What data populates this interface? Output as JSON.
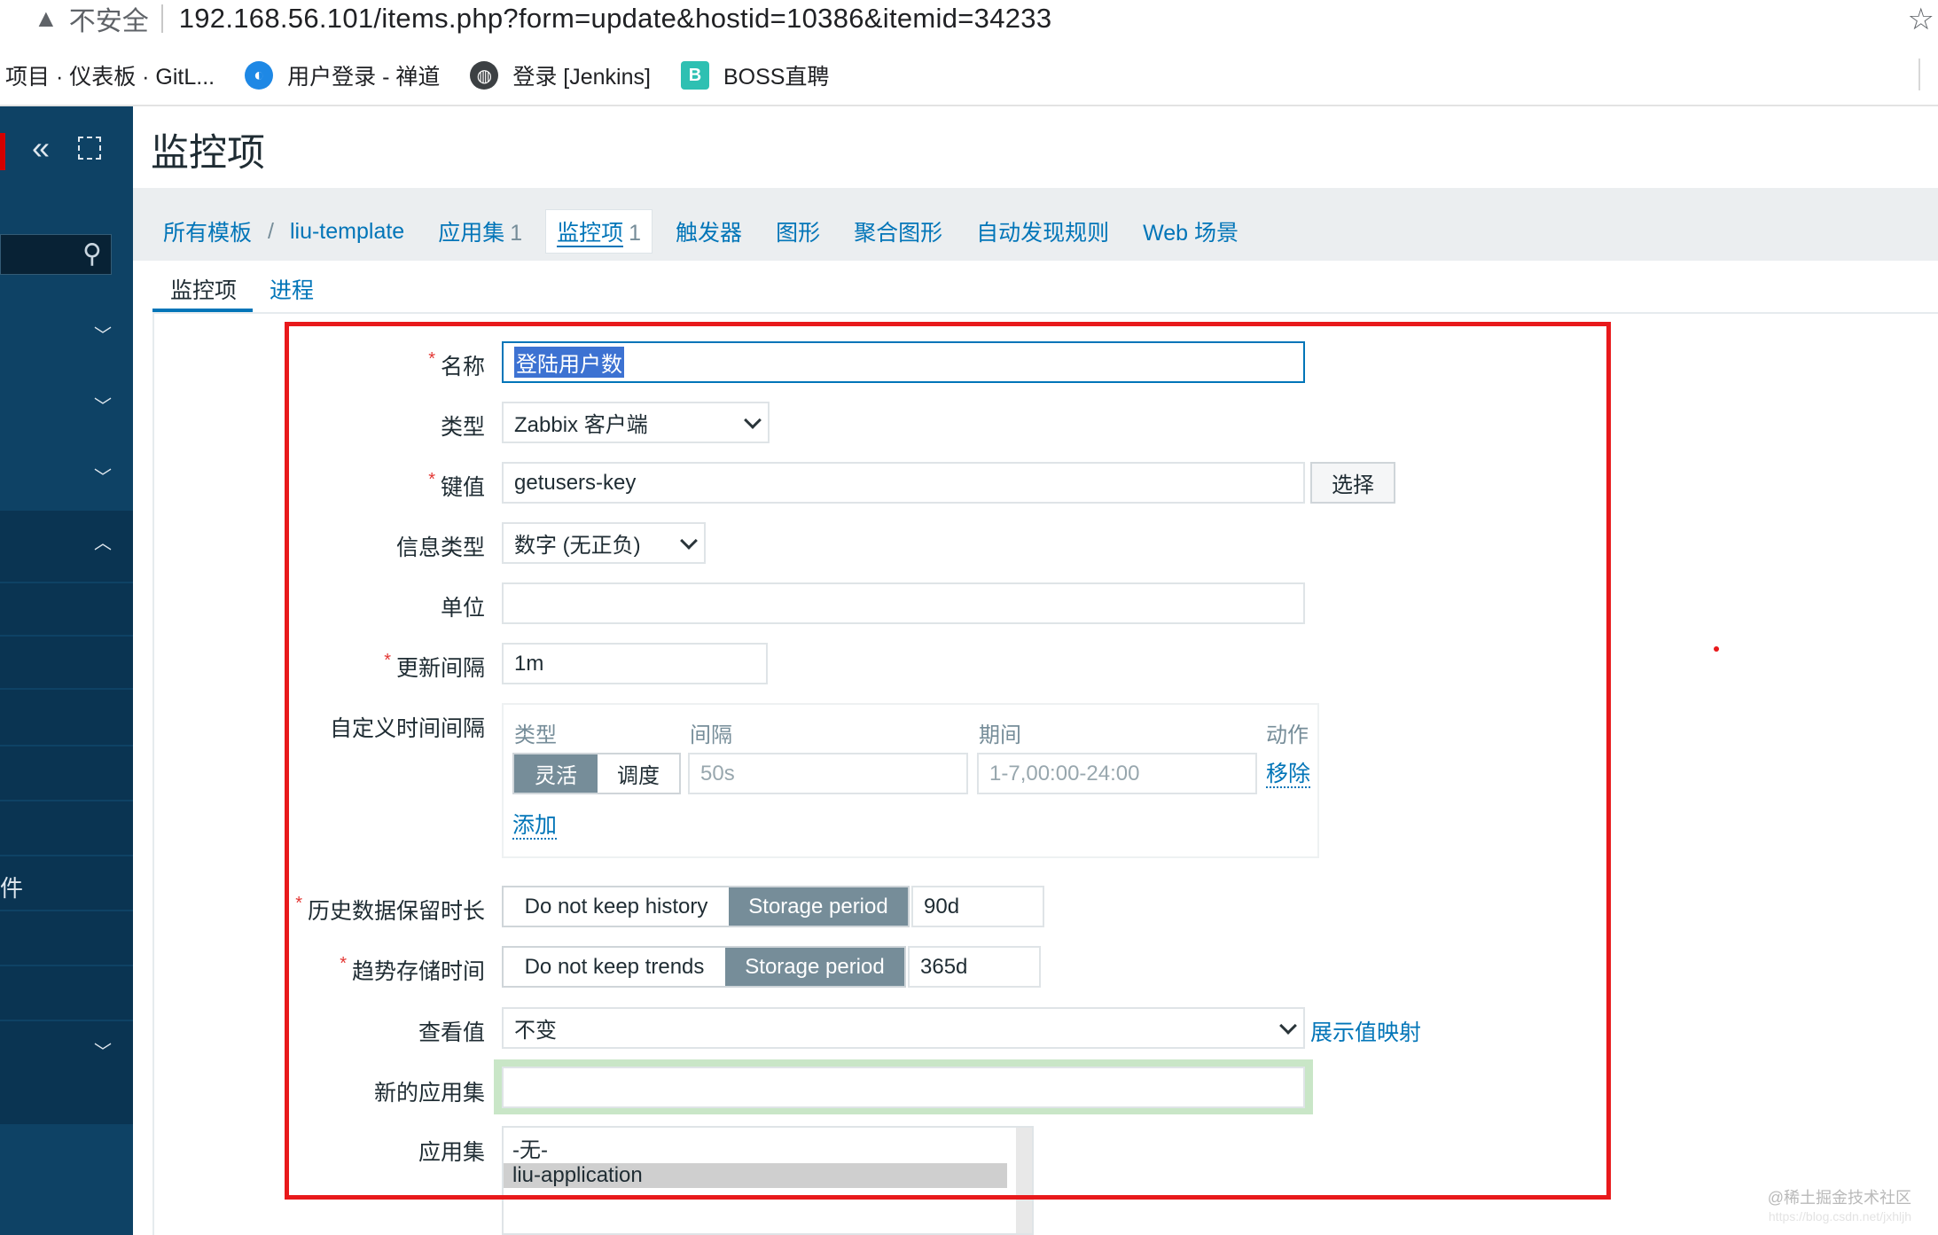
{
  "browser": {
    "insecure_label": "不安全",
    "url": "192.168.56.101/items.php?form=update&hostid=10386&itemid=34233",
    "bookmarks": [
      {
        "label": "项目 · 仪表板 · GitL...",
        "icon": ""
      },
      {
        "label": "用户登录 - 禅道",
        "icon": "chandao-icon",
        "color": "#1e88e5"
      },
      {
        "label": "登录 [Jenkins]",
        "icon": "globe-icon",
        "color": "#3c4043"
      },
      {
        "label": "BOSS直聘",
        "icon": "boss-icon",
        "color": "#2ec0b2",
        "glyph": "B"
      }
    ]
  },
  "sidebar": {
    "fragments": [
      "",
      "",
      "件"
    ],
    "colors": {
      "bg": "#0e4265",
      "active": "#0a3452"
    }
  },
  "header": {
    "title": "监控项"
  },
  "breadcrumb": {
    "all_templates": "所有模板",
    "template": "liu-template",
    "applications": "应用集",
    "applications_count": "1",
    "items": "监控项",
    "items_count": "1",
    "triggers": "触发器",
    "graphs": "图形",
    "screens": "聚合图形",
    "discovery": "自动发现规则",
    "web": "Web 场景"
  },
  "tabs": {
    "item": "监控项",
    "process": "进程"
  },
  "form": {
    "name": {
      "label": "名称",
      "value": "登陆用户数",
      "required": true
    },
    "type": {
      "label": "类型",
      "value": "Zabbix 客户端"
    },
    "key": {
      "label": "键值",
      "value": "getusers-key",
      "button": "选择",
      "required": true
    },
    "info_type": {
      "label": "信息类型",
      "value": "数字 (无正负)"
    },
    "units": {
      "label": "单位",
      "value": ""
    },
    "interval": {
      "label": "更新间隔",
      "value": "1m",
      "required": true
    },
    "custom_intervals": {
      "label": "自定义时间间隔",
      "col_type": "类型",
      "col_interval": "间隔",
      "col_period": "期间",
      "col_action": "动作",
      "mode_flexible": "灵活",
      "mode_scheduling": "调度",
      "interval_placeholder": "50s",
      "period_placeholder": "1-7,00:00-24:00",
      "remove": "移除",
      "add": "添加"
    },
    "history": {
      "label": "历史数据保留时长",
      "opt_off": "Do not keep history",
      "opt_on": "Storage period",
      "value": "90d",
      "required": true
    },
    "trends": {
      "label": "趋势存储时间",
      "opt_off": "Do not keep trends",
      "opt_on": "Storage period",
      "value": "365d",
      "required": true
    },
    "valuemap": {
      "label": "查看值",
      "value": "不变",
      "link": "展示值映射"
    },
    "new_application": {
      "label": "新的应用集",
      "value": ""
    },
    "applications": {
      "label": "应用集",
      "options": [
        "-无-",
        "liu-application"
      ],
      "selected": "liu-application"
    }
  },
  "watermark": "@稀土掘金技术社区",
  "watermark_url": "https://blog.csdn.net/jxhljh",
  "colors": {
    "link": "#0275b8",
    "annotation": "#e8191b",
    "required": "#e33734"
  }
}
